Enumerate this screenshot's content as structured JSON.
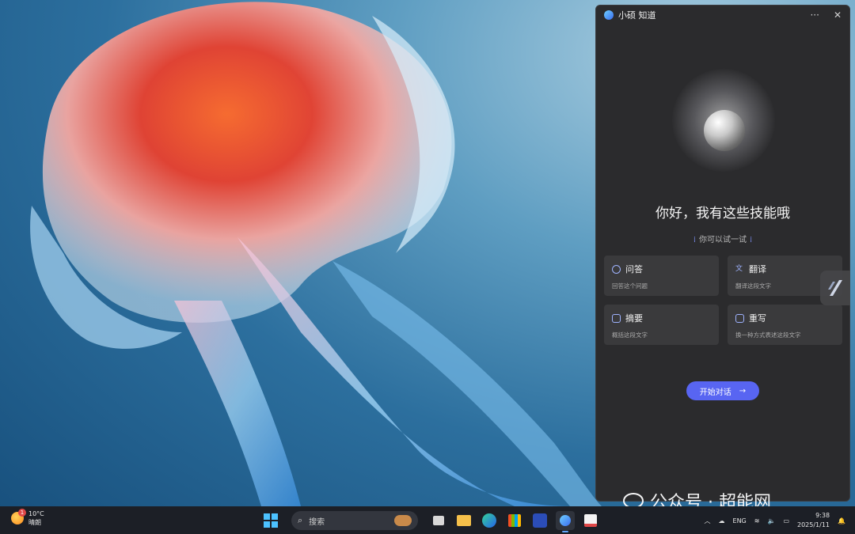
{
  "panel": {
    "title": "小硕 知道",
    "more_label": "···",
    "close_label": "✕",
    "greeting": "你好，我有这些技能哦",
    "hint": "你可以试一试",
    "cards": [
      {
        "title": "问答",
        "desc": "回答这个问题",
        "icon": "chat-icon"
      },
      {
        "title": "翻译",
        "desc": "翻译这段文字",
        "icon": "translate-icon"
      },
      {
        "title": "摘要",
        "desc": "概括这段文字",
        "icon": "summary-icon"
      },
      {
        "title": "重写",
        "desc": "换一种方式表述这段文字",
        "icon": "rewrite-icon"
      }
    ],
    "start_label": "开始对话",
    "start_arrow": "→",
    "accent": "#5865f2"
  },
  "taskbar": {
    "weather": {
      "temp": "10°C",
      "cond": "晴朗",
      "badge": "1"
    },
    "search_placeholder": "搜索",
    "tray": {
      "lang": "ENG",
      "time": "9:38",
      "date": "2025/1/11"
    }
  },
  "watermark": "公众号 · 超能网"
}
